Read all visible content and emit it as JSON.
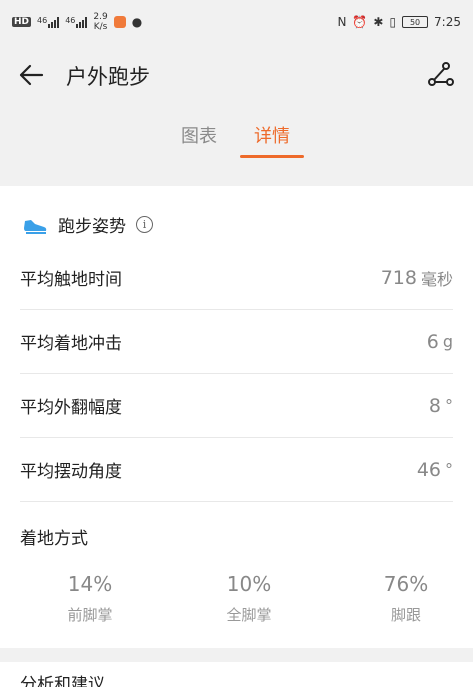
{
  "status_bar": {
    "net_badge": "HD",
    "sig1_label": "46",
    "sig2_label": "46",
    "speed_value": "2.9",
    "speed_unit": "K/s",
    "battery": "50",
    "time": "7:25"
  },
  "header": {
    "title": "户外跑步",
    "tabs": [
      {
        "label": "图表"
      },
      {
        "label": "详情"
      }
    ]
  },
  "section": {
    "title": "跑步姿势",
    "info_glyph": "i",
    "metrics": [
      {
        "label": "平均触地时间",
        "value": "718",
        "unit": "毫秒"
      },
      {
        "label": "平均着地冲击",
        "value": "6",
        "unit": "g"
      },
      {
        "label": "平均外翻幅度",
        "value": "8",
        "unit": "°"
      },
      {
        "label": "平均摆动角度",
        "value": "46",
        "unit": "°"
      }
    ],
    "landing": {
      "title": "着地方式",
      "items": [
        {
          "pct": "14%",
          "name": "前脚掌"
        },
        {
          "pct": "10%",
          "name": "全脚掌"
        },
        {
          "pct": "76%",
          "name": "脚跟"
        }
      ]
    }
  },
  "analysis": {
    "title": "分析和建议"
  },
  "colors": {
    "accent": "#ee6a2a",
    "shoe_icon": "#3aa0e8",
    "band": "#f1f1f1"
  }
}
